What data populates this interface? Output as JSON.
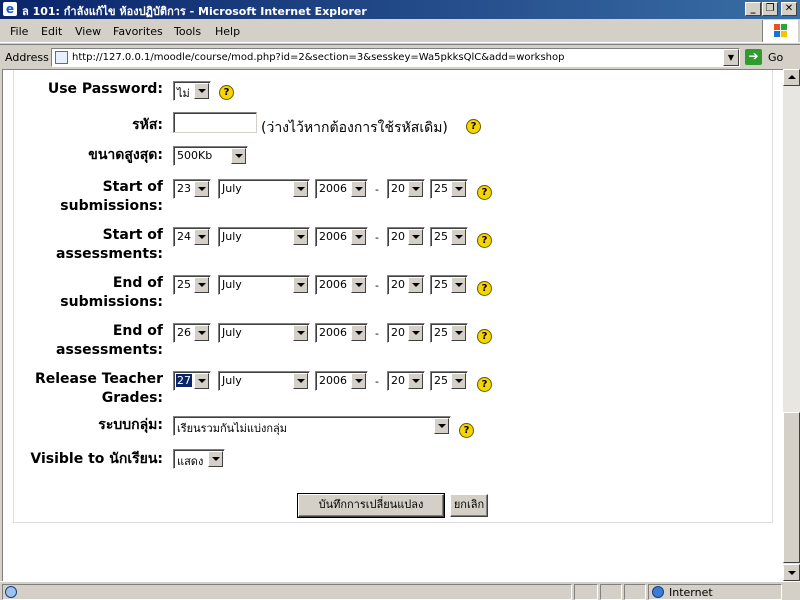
{
  "window": {
    "title": "ล 101: กำลังแก้ไข ห้องปฏิบัติการ - Microsoft Internet Explorer",
    "minimize_glyph": "_",
    "restore_glyph": "❐",
    "close_glyph": "✕"
  },
  "menu": [
    "File",
    "Edit",
    "View",
    "Favorites",
    "Tools",
    "Help"
  ],
  "address": {
    "label": "Address",
    "url": "http://127.0.0.1/moodle/course/mod.php?id=2&section=3&sesskey=Wa5pkksQlC&add=workshop",
    "go_label": "Go"
  },
  "form": {
    "use_password": {
      "label": "Use Password:",
      "value": "ไม่"
    },
    "password": {
      "label": "รหัส:",
      "value": "",
      "hint": "(ว่างไว้หากต้องการใช้รหัสเดิม)"
    },
    "max_size": {
      "label": "ขนาดสูงสุด:",
      "value": "500Kb"
    },
    "dates": [
      {
        "label1": "Start of",
        "label2": "submissions:",
        "day": "23",
        "month": "July",
        "year": "2006",
        "hour": "20",
        "minute": "25"
      },
      {
        "label1": "Start of",
        "label2": "assessments:",
        "day": "24",
        "month": "July",
        "year": "2006",
        "hour": "20",
        "minute": "25"
      },
      {
        "label1": "End of",
        "label2": "submissions:",
        "day": "25",
        "month": "July",
        "year": "2006",
        "hour": "20",
        "minute": "25"
      },
      {
        "label1": "End of",
        "label2": "assessments:",
        "day": "26",
        "month": "July",
        "year": "2006",
        "hour": "20",
        "minute": "25"
      },
      {
        "label1": "Release Teacher",
        "label2": "Grades:",
        "day": "27",
        "month": "July",
        "year": "2006",
        "hour": "20",
        "minute": "25"
      }
    ],
    "date_separator": "-",
    "group_mode": {
      "label": "ระบบกลุ่ม:",
      "value": "เรียนรวมกันไม่แบ่งกลุ่ม"
    },
    "visible": {
      "label": "Visible to นักเรียน:",
      "value": "แสดง"
    },
    "help_glyph": "?",
    "save_label": "บันทึกการเปลี่ยนแปลง",
    "cancel_label": "ยกเลิก"
  },
  "status": {
    "zone": "Internet"
  }
}
